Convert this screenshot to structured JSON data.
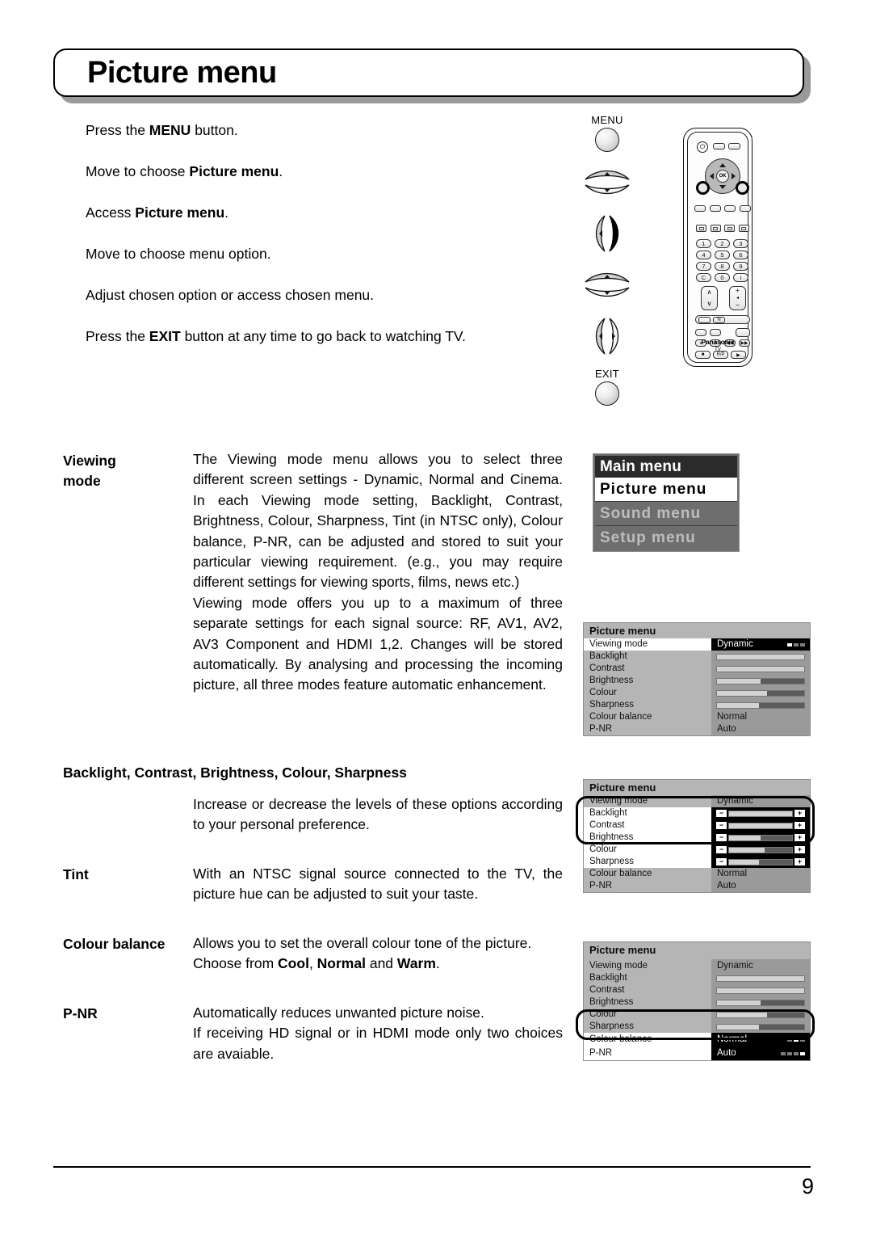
{
  "header": {
    "title": "Picture menu"
  },
  "instructions": [
    {
      "pre": "Press the ",
      "strong": "MENU",
      "post": " button."
    },
    {
      "pre": "Move to choose ",
      "strong": "Picture menu",
      "post": "."
    },
    {
      "pre": "Access ",
      "strong": "Picture menu",
      "post": "."
    },
    {
      "pre": "Move to choose menu option.",
      "strong": "",
      "post": ""
    },
    {
      "pre": "Adjust chosen option or access chosen menu.",
      "strong": "",
      "post": ""
    },
    {
      "pre": "Press the ",
      "strong": "EXIT",
      "post": " button at any time to go back to watching TV."
    }
  ],
  "keys": {
    "menu_label": "MENU",
    "exit_label": "EXIT"
  },
  "remote": {
    "brand": "Panasonic",
    "brand_sub": "TV",
    "ok_label": "OK",
    "power_glyph": "⏻",
    "numbers": [
      "1",
      "2",
      "3",
      "4",
      "5",
      "6",
      "7",
      "8",
      "9",
      "C",
      "0",
      "i"
    ],
    "ch_up": "∧",
    "ch_down": "∨",
    "vol_up": "+",
    "vol_down": "−",
    "vol_mid": "◂",
    "wide_label": "N",
    "vcr": [
      "■",
      "R/P",
      "▶"
    ],
    "transport": [
      "∨",
      "∧",
      "◀◀",
      "▶▶"
    ]
  },
  "sections": [
    {
      "term": "Viewing mode",
      "paragraphs": [
        "The Viewing mode menu allows you to select three different screen settings - Dynamic, Normal and Cinema. In each Viewing mode setting, Backlight, Contrast, Brightness, Colour, Sharpness, Tint (in NTSC only), Colour balance, P-NR, can be adjusted and stored to suit your particular viewing requirement. (e.g., you may require different settings for viewing sports, films, news etc.)",
        "Viewing mode offers you up to a maximum of three separate settings for each signal source: RF, AV1, AV2, AV3 Component and HDMI 1,2. Changes will be stored automatically. By analysing and processing the incoming picture, all three modes feature automatic enhancement."
      ]
    },
    {
      "term": "Backlight, Contrast, Brightness, Colour, Sharpness",
      "paragraphs": [
        "Increase or decrease the levels of these options according to your personal preference."
      ]
    },
    {
      "term": "Tint",
      "paragraphs": [
        "With an NTSC signal source connected to the TV, the picture hue can be adjusted to suit your taste."
      ]
    },
    {
      "term": "Colour balance",
      "line1": "Allows you to set the overall colour tone of the picture.",
      "line2_pre": "Choose from ",
      "line2_opts": [
        "Cool",
        "Normal",
        "Warm"
      ],
      "line2_sep1": ", ",
      "line2_sep2": " and ",
      "line2_post": "."
    },
    {
      "term": "P-NR",
      "paragraphs": [
        "Automatically reduces unwanted picture noise.",
        "If receiving HD signal or in HDMI mode only two choices are avaiable."
      ]
    }
  ],
  "main_menu": {
    "header": "Main menu",
    "selected": "Picture menu",
    "items": [
      "Sound menu",
      "Setup menu"
    ]
  },
  "osd": {
    "title": "Picture menu",
    "rows": [
      {
        "label": "Viewing mode",
        "value": "Dynamic",
        "kind": "text"
      },
      {
        "label": "Backlight",
        "value": "",
        "kind": "bar",
        "fill": 100
      },
      {
        "label": "Contrast",
        "value": "",
        "kind": "bar",
        "fill": 100
      },
      {
        "label": "Brightness",
        "value": "",
        "kind": "bar",
        "fill": 50
      },
      {
        "label": "Colour",
        "value": "",
        "kind": "bar",
        "fill": 57
      },
      {
        "label": "Sharpness",
        "value": "",
        "kind": "bar",
        "fill": 48
      },
      {
        "label": "Colour balance",
        "value": "Normal",
        "kind": "text"
      },
      {
        "label": "P-NR",
        "value": "Auto",
        "kind": "text"
      }
    ],
    "viewing_mode_dots": {
      "count": 3,
      "active": 0
    },
    "colour_balance_dots": {
      "count": 3,
      "active": 1
    },
    "pnr_dots": {
      "count": 4,
      "active": 3
    },
    "minus": "−",
    "plus": "+"
  },
  "footer": {
    "page_number": "9"
  },
  "colors": {
    "osd_panel": "#b5b5b5",
    "osd_value_bg": "#9a9a9a",
    "osd_highlight_bg": "#000000",
    "osd_highlight_fg": "#ffffff",
    "main_menu_header_bg": "#2b2b2b",
    "main_menu_bg": "#6e6e6e",
    "bar_fill": "#d2d2d2",
    "bar_track": "#5b5b5b"
  }
}
